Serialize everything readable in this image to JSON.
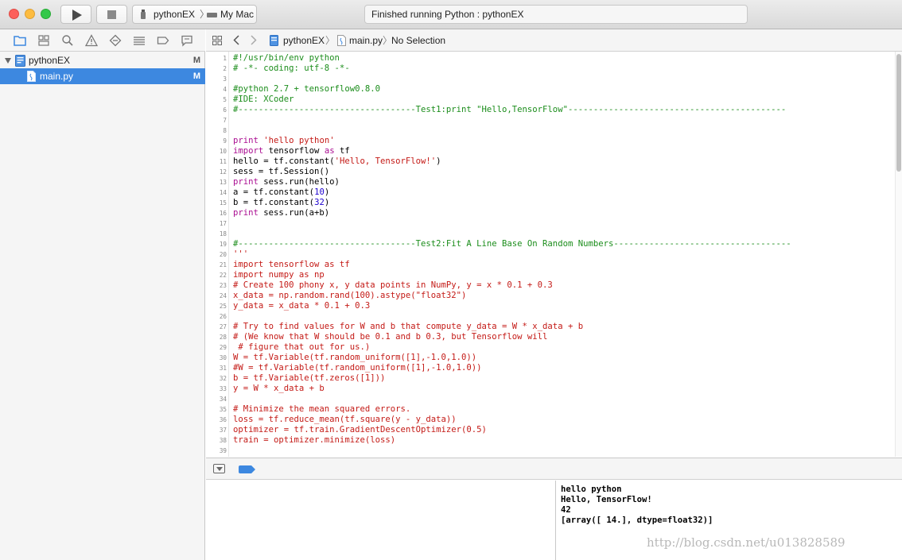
{
  "toolbar": {
    "scheme_name": "pythonEX",
    "scheme_separator": "〉",
    "destination": "My Mac",
    "activity_status": "Finished running Python : pythonEX"
  },
  "navigator": {
    "project": {
      "name": "pythonEX",
      "status": "M"
    },
    "files": [
      {
        "name": "main.py",
        "status": "M"
      }
    ]
  },
  "jumpbar": {
    "project": "pythonEX",
    "file": "main.py",
    "selection": "No Selection",
    "separator": "〉"
  },
  "editor": {
    "lines": [
      {
        "n": "1",
        "tokens": [
          {
            "t": "#!/usr/bin/env python",
            "c": "comment"
          }
        ]
      },
      {
        "n": "2",
        "tokens": [
          {
            "t": "# -*- coding: utf-8 -*-",
            "c": "comment"
          }
        ]
      },
      {
        "n": "3",
        "tokens": []
      },
      {
        "n": "4",
        "tokens": [
          {
            "t": "#python 2.7 + tensorflow0.8.0",
            "c": "comment"
          }
        ]
      },
      {
        "n": "5",
        "tokens": [
          {
            "t": "#IDE: XCoder",
            "c": "comment"
          }
        ]
      },
      {
        "n": "6",
        "tokens": [
          {
            "t": "#-----------------------------------Test1:print \"Hello,TensorFlow\"-------------------------------------------",
            "c": "comment"
          }
        ]
      },
      {
        "n": "7",
        "tokens": []
      },
      {
        "n": "8",
        "tokens": []
      },
      {
        "n": "9",
        "tokens": [
          {
            "t": "print",
            "c": "keyword"
          },
          {
            "t": " "
          },
          {
            "t": "'hello python'",
            "c": "string"
          }
        ]
      },
      {
        "n": "10",
        "tokens": [
          {
            "t": "import",
            "c": "keyword"
          },
          {
            "t": " tensorflow "
          },
          {
            "t": "as",
            "c": "keyword"
          },
          {
            "t": " tf"
          }
        ]
      },
      {
        "n": "11",
        "tokens": [
          {
            "t": "hello = tf.constant("
          },
          {
            "t": "'Hello, TensorFlow!'",
            "c": "string"
          },
          {
            "t": ")"
          }
        ]
      },
      {
        "n": "12",
        "tokens": [
          {
            "t": "sess = tf.Session()"
          }
        ]
      },
      {
        "n": "13",
        "tokens": [
          {
            "t": "print",
            "c": "keyword"
          },
          {
            "t": " sess.run(hello)"
          }
        ]
      },
      {
        "n": "14",
        "tokens": [
          {
            "t": "a = tf.constant("
          },
          {
            "t": "10",
            "c": "number"
          },
          {
            "t": ")"
          }
        ]
      },
      {
        "n": "15",
        "tokens": [
          {
            "t": "b = tf.constant("
          },
          {
            "t": "32",
            "c": "number"
          },
          {
            "t": ")"
          }
        ]
      },
      {
        "n": "16",
        "tokens": [
          {
            "t": "print",
            "c": "keyword"
          },
          {
            "t": " sess.run(a+b)"
          }
        ]
      },
      {
        "n": "17",
        "tokens": []
      },
      {
        "n": "18",
        "tokens": []
      },
      {
        "n": "19",
        "tokens": [
          {
            "t": "#-----------------------------------Test2:Fit A Line Base On Random Numbers-----------------------------------",
            "c": "comment"
          }
        ]
      },
      {
        "n": "20",
        "tokens": [
          {
            "t": "'''",
            "c": "string"
          }
        ]
      },
      {
        "n": "21",
        "tokens": [
          {
            "t": "import tensorflow as tf",
            "c": "string"
          }
        ]
      },
      {
        "n": "22",
        "tokens": [
          {
            "t": "import numpy as np",
            "c": "string"
          }
        ]
      },
      {
        "n": "23",
        "tokens": [
          {
            "t": "# Create 100 phony x, y data points in NumPy, y = x * 0.1 + 0.3",
            "c": "string"
          }
        ]
      },
      {
        "n": "24",
        "tokens": [
          {
            "t": "x_data = np.random.rand(100).astype(\"float32\")",
            "c": "string"
          }
        ]
      },
      {
        "n": "25",
        "tokens": [
          {
            "t": "y_data = x_data * 0.1 + 0.3",
            "c": "string"
          }
        ]
      },
      {
        "n": "26",
        "tokens": []
      },
      {
        "n": "27",
        "tokens": [
          {
            "t": "# Try to find values for W and b that compute y_data = W * x_data + b",
            "c": "string"
          }
        ]
      },
      {
        "n": "28",
        "tokens": [
          {
            "t": "# (We know that W should be 0.1 and b 0.3, but Tensorflow will",
            "c": "string"
          }
        ]
      },
      {
        "n": "29",
        "tokens": [
          {
            "t": " # figure that out for us.)",
            "c": "string"
          }
        ]
      },
      {
        "n": "30",
        "tokens": [
          {
            "t": "W = tf.Variable(tf.random_uniform([1],-1.0,1.0))",
            "c": "string"
          }
        ]
      },
      {
        "n": "31",
        "tokens": [
          {
            "t": "#W = tf.Variable(tf.random_uniform([1],-1.0,1.0))",
            "c": "string"
          }
        ]
      },
      {
        "n": "32",
        "tokens": [
          {
            "t": "b = tf.Variable(tf.zeros([1]))",
            "c": "string"
          }
        ]
      },
      {
        "n": "33",
        "tokens": [
          {
            "t": "y = W * x_data + b",
            "c": "string"
          }
        ]
      },
      {
        "n": "34",
        "tokens": []
      },
      {
        "n": "35",
        "tokens": [
          {
            "t": "# Minimize the mean squared errors.",
            "c": "string"
          }
        ]
      },
      {
        "n": "36",
        "tokens": [
          {
            "t": "loss = tf.reduce_mean(tf.square(y - y_data))",
            "c": "string"
          }
        ]
      },
      {
        "n": "37",
        "tokens": [
          {
            "t": "optimizer = tf.train.GradientDescentOptimizer(0.5)",
            "c": "string"
          }
        ]
      },
      {
        "n": "38",
        "tokens": [
          {
            "t": "train = optimizer.minimize(loss)",
            "c": "string"
          }
        ]
      },
      {
        "n": "39",
        "tokens": []
      }
    ]
  },
  "console": {
    "lines": [
      "hello python",
      "Hello, TensorFlow!",
      "42",
      "[array([ 14.], dtype=float32)]"
    ]
  },
  "watermark": "http://blog.csdn.net/u013828589",
  "colors": {
    "accent": "#3d88e0",
    "comment": "#1b8d1b",
    "string": "#c41a16",
    "keyword": "#aa0d91",
    "number": "#1c00cf"
  },
  "icons": {
    "toolbar": [
      "run-icon",
      "stop-icon",
      "python-file-icon",
      "mac-icon"
    ],
    "navigator_tabs": [
      "project-navigator-icon",
      "source-control-navigator-icon",
      "find-navigator-icon",
      "issue-navigator-icon",
      "test-navigator-icon",
      "debug-navigator-icon",
      "breakpoint-navigator-icon",
      "report-navigator-icon"
    ]
  }
}
